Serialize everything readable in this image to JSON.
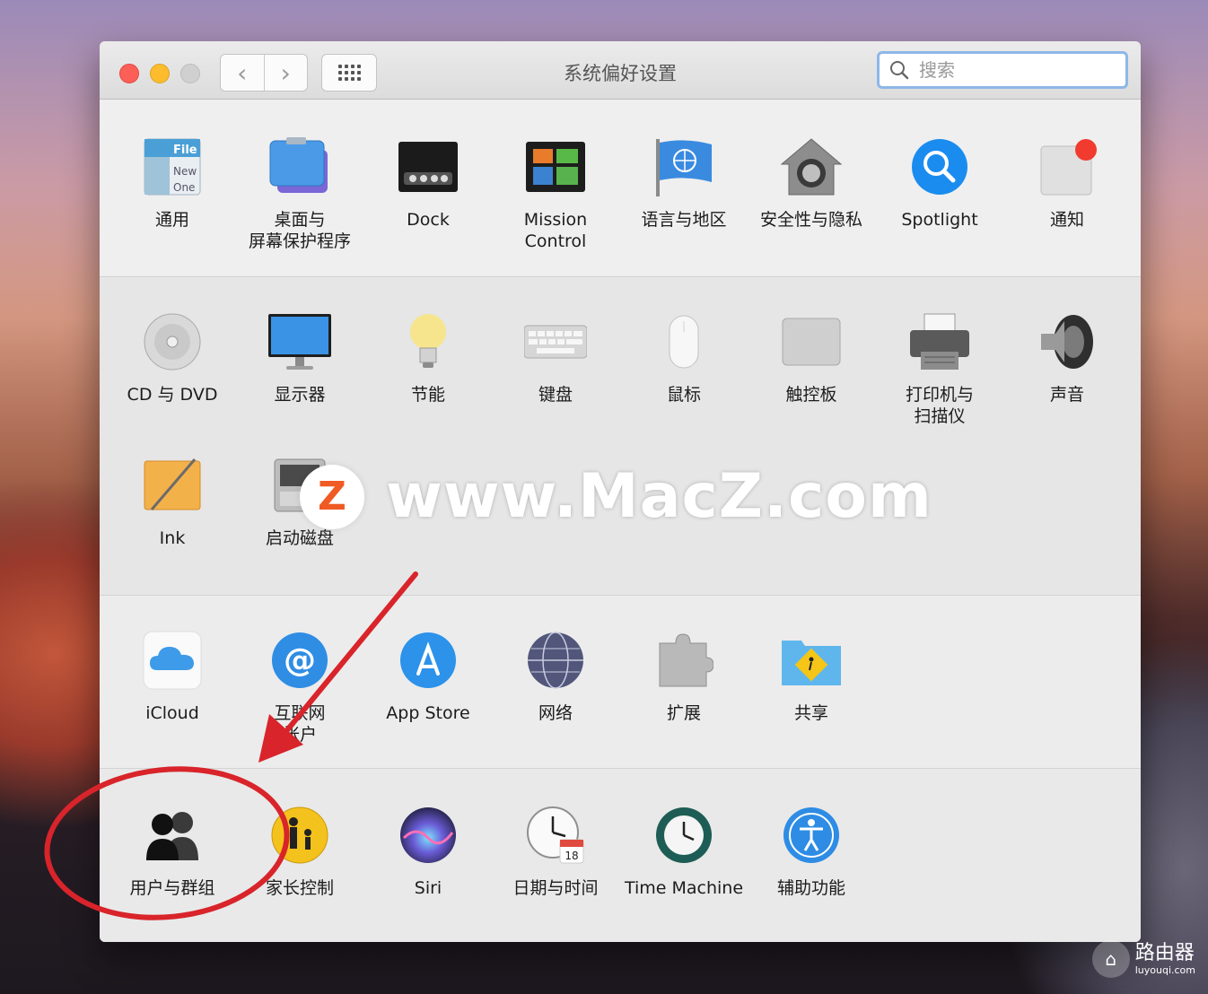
{
  "window": {
    "title": "系统偏好设置"
  },
  "nav": {
    "back": "‹",
    "forward": "›"
  },
  "search": {
    "placeholder": "搜索"
  },
  "rows": {
    "r1": [
      "通用",
      "桌面与\n屏幕保护程序",
      "Dock",
      "Mission\nControl",
      "语言与地区",
      "安全性与隐私",
      "Spotlight",
      "通知"
    ],
    "r2": [
      "CD 与 DVD",
      "显示器",
      "节能",
      "键盘",
      "鼠标",
      "触控板",
      "打印机与\n扫描仪",
      "声音"
    ],
    "r3": [
      "Ink",
      "启动磁盘"
    ],
    "r4": [
      "iCloud",
      "互联网\n帐户",
      "App Store",
      "网络",
      "扩展",
      "共享"
    ],
    "r5": [
      "用户与群组",
      "家长控制",
      "Siri",
      "日期与时间",
      "Time Machine",
      "辅助功能"
    ]
  },
  "icons": {
    "general": "general-icon",
    "desktop": "desktop-screensaver-icon",
    "dock": "dock-icon",
    "mission": "mission-control-icon",
    "language": "language-region-icon",
    "security": "security-privacy-icon",
    "spotlight": "spotlight-icon",
    "notifications": "notifications-icon"
  },
  "general_icon_text": "File New One",
  "calendar_day": "18",
  "watermark": {
    "logo": "Z",
    "text": "www.MacZ.com"
  },
  "corner_badge": {
    "title": "路由器",
    "sub": "luyouqi.com"
  },
  "colors": {
    "annotation": "#d8242a",
    "accent": "#1a8cf0"
  }
}
